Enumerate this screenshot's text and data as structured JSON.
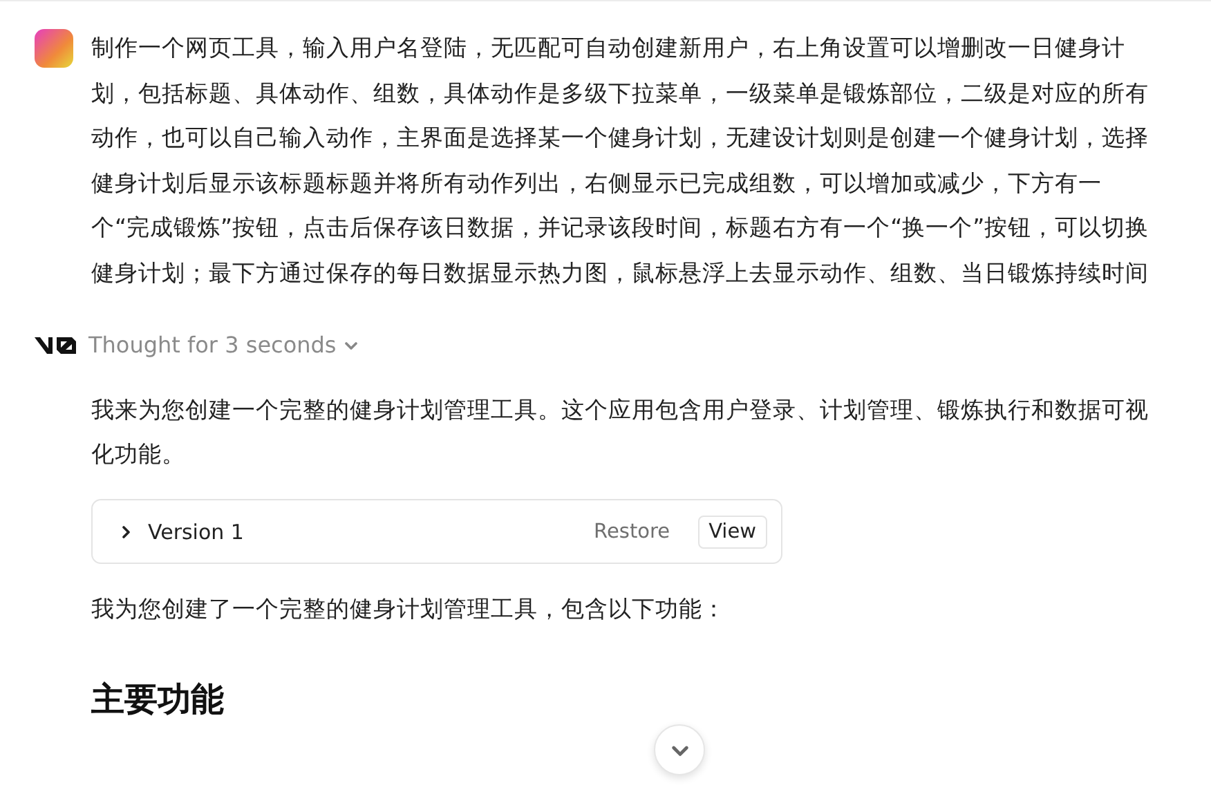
{
  "user_message": {
    "text": "制作一个网页工具，输入用户名登陆，无匹配可自动创建新用户，右上角设置可以增删改一日健身计划，包括标题、具体动作、组数，具体动作是多级下拉菜单，一级菜单是锻炼部位，二级是对应的所有动作，也可以自己输入动作，主界面是选择某一个健身计划，无建设计划则是创建一个健身计划，选择健身计划后显示该标题标题并将所有动作列出，右侧显示已完成组数，可以增加或减少，下方有一个“完成锻炼”按钮，点击后保存该日数据，并记录该段时间，标题右方有一个“换一个”按钮，可以切换健身计划；最下方通过保存的每日数据显示热力图，鼠标悬浮上去显示动作、组数、当日锻炼持续时间"
  },
  "assistant": {
    "thought": {
      "label": "Thought for 3 seconds",
      "expanded": false
    },
    "intro": "我来为您创建一个完整的健身计划管理工具。这个应用包含用户登录、计划管理、锻炼执行和数据可视化功能。",
    "version_card": {
      "title": "Version 1",
      "expanded": false,
      "actions": [
        "Restore",
        "View"
      ]
    },
    "summary": "我为您创建了一个完整的健身计划管理工具，包含以下功能：",
    "heading": "主要功能"
  }
}
